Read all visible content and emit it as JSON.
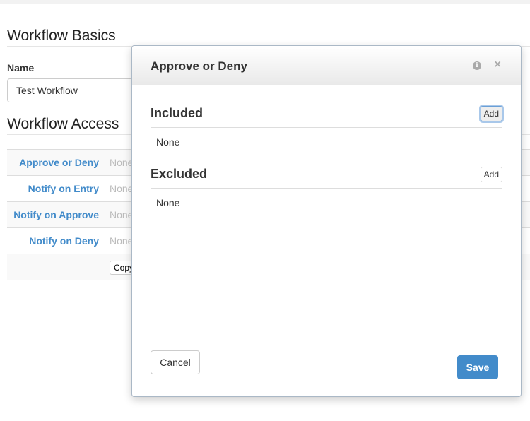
{
  "page": {
    "basics_title": "Workflow Basics",
    "name_label": "Name",
    "name_value": "Test Workflow",
    "access_title": "Workflow Access",
    "access_rows": [
      {
        "label": "Approve or Deny",
        "value": "None"
      },
      {
        "label": "Notify on Entry",
        "value": "None"
      },
      {
        "label": "Notify on Approve",
        "value": "None"
      },
      {
        "label": "Notify on Deny",
        "value": "None"
      }
    ],
    "copy_label": "Copy"
  },
  "modal": {
    "title": "Approve or Deny",
    "info_icon": "info-icon",
    "close_icon": "close-icon",
    "included": {
      "title": "Included",
      "add": "Add",
      "value": "None"
    },
    "excluded": {
      "title": "Excluded",
      "add": "Add",
      "value": "None"
    },
    "cancel": "Cancel",
    "save": "Save",
    "accent": "#428bca"
  }
}
